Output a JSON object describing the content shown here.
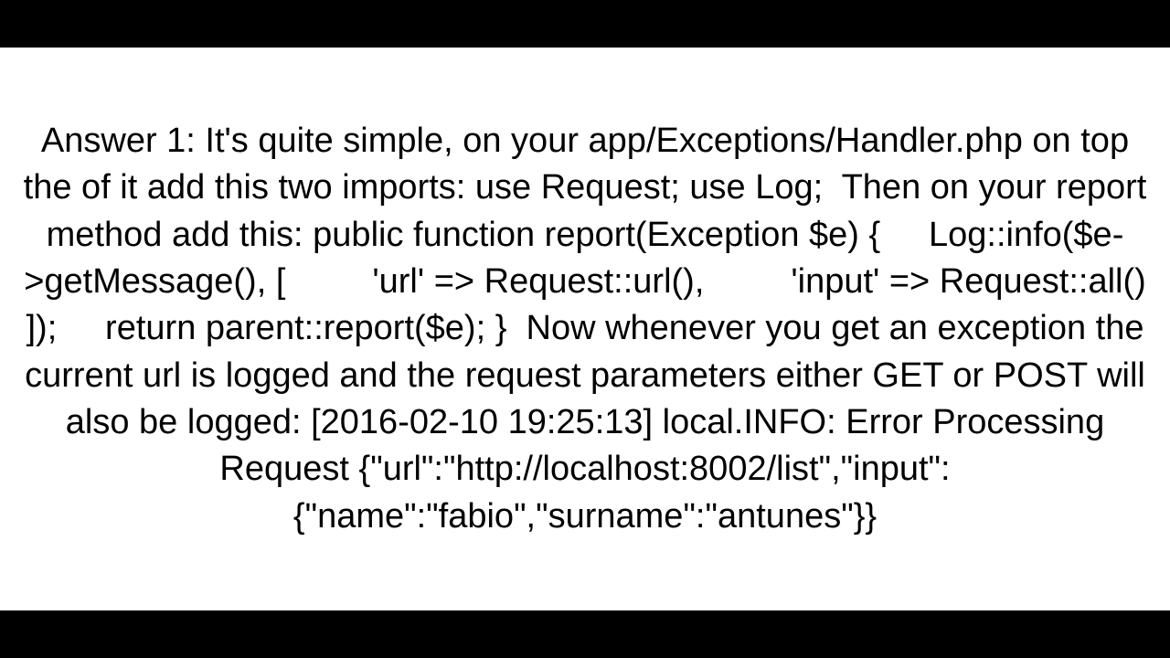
{
  "answer": {
    "body": "Answer 1: It's quite simple, on your app/Exceptions/Handler.php on top the of it add this two imports: use Request; use Log;  Then on your report method add this: public function report(Exception $e) {     Log::info($e->getMessage(), [         'url' => Request::url(),         'input' => Request::all()     ]);     return parent::report($e); }  Now whenever you get an exception the current url is logged and the request parameters either GET or POST will also be logged: [2016-02-10 19:25:13] local.INFO: Error Processing Request {\"url\":\"http://localhost:8002/list\",\"input\":{\"name\":\"fabio\",\"surname\":\"antunes\"}}"
  }
}
